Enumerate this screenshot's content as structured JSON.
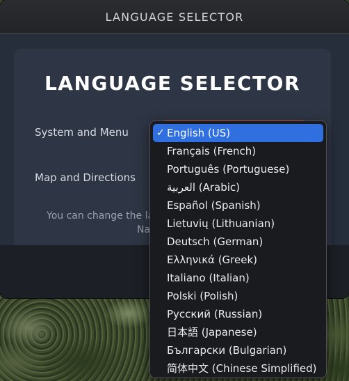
{
  "window": {
    "title": "LANGUAGE SELECTOR"
  },
  "panel": {
    "title": "LANGUAGE SELECTOR",
    "system_menu_label": "System and Menu",
    "map_directions_label": "Map and Directions",
    "hint_line1": "You can change the lan",
    "hint_line2": "Na"
  },
  "dropdown": {
    "selected_index": 0,
    "check_glyph": "✓",
    "options": [
      "English (US)",
      "Français (French)",
      "Português (Portuguese)",
      "العربية (Arabic)",
      "Español (Spanish)",
      "Lietuvių (Lithuanian)",
      "Deutsch (German)",
      "Ελληνικά (Greek)",
      "Italiano (Italian)",
      "Polski (Polish)",
      "Русский (Russian)",
      "日本語 (Japanese)",
      "Български (Bulgarian)",
      "简体中文 (Chinese Simplified)"
    ]
  },
  "colors": {
    "accent": "#2f6fe0",
    "window_bg": "#1e2127",
    "panel_bg": "#2e3544"
  }
}
